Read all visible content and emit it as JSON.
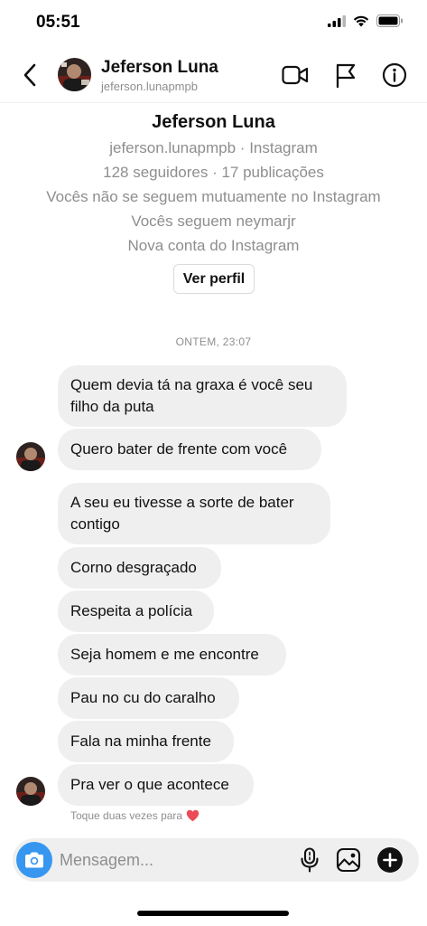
{
  "status_bar": {
    "time": "05:51"
  },
  "header": {
    "name": "Jeferson Luna",
    "username": "jeferson.lunapmpb",
    "icons": [
      "back-chevron-icon",
      "video-camera-icon",
      "flag-icon",
      "info-icon"
    ]
  },
  "profile": {
    "name": "Jeferson Luna",
    "lines": [
      "jeferson.lunapmpb · Instagram",
      "128 seguidores · 17 publicações",
      "Vocês não se seguem mutuamente no Instagram",
      "Vocês seguem neymarjr",
      "Nova conta do Instagram"
    ],
    "view_profile_label": "Ver perfil"
  },
  "timestamp": "ONTEM, 23:07",
  "messages": [
    "Quem devia tá na graxa é você seu filho da puta",
    "Quero bater de frente com você",
    "A seu eu tivesse a sorte de bater contigo",
    "Corno desgraçado",
    "Respeita a polícia",
    "Seja homem e me encontre",
    "Pau no cu do caralho",
    "Fala na minha frente",
    "Pra ver o que acontece"
  ],
  "hint": "Toque duas vezes para",
  "composer": {
    "placeholder": "Mensagem...",
    "icons": [
      "camera-icon",
      "microphone-icon",
      "gallery-icon",
      "add-icon"
    ]
  },
  "colors": {
    "accent": "#3797f0",
    "bubble": "#efefef",
    "secondary_text": "#8e8e8e",
    "heart": "#ed4956"
  }
}
